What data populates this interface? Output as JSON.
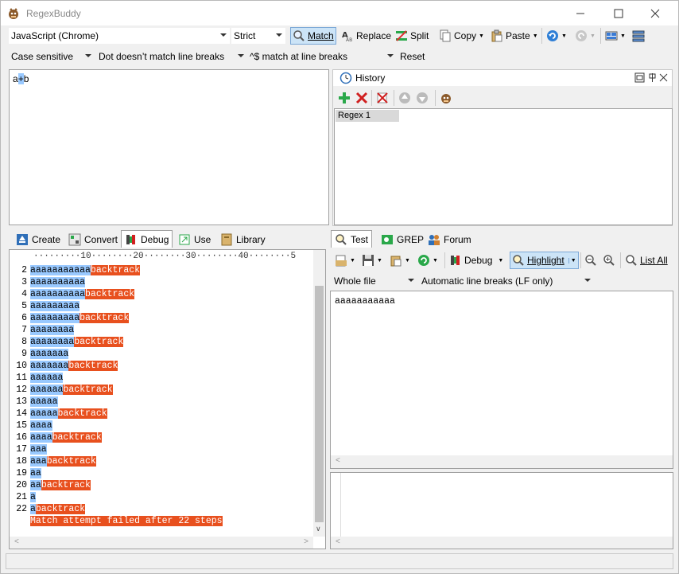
{
  "window": {
    "title": "RegexBuddy"
  },
  "toolbar1": {
    "flavor": "JavaScript (Chrome)",
    "mode": "Strict",
    "match": "Match",
    "replace": "Replace",
    "split": "Split",
    "copy": "Copy",
    "paste": "Paste"
  },
  "toolbar2": {
    "case": "Case sensitive",
    "dot": "Dot doesn’t match line breaks",
    "anchors": "^$ match at line breaks",
    "reset": "Reset"
  },
  "regex": {
    "before": "a",
    "cursor": "+",
    "after": "b"
  },
  "history": {
    "title": "History",
    "items": [
      "Regex 1"
    ]
  },
  "left_tabs": [
    "Create",
    "Convert",
    "Debug",
    "Use",
    "Library"
  ],
  "ruler": "·········10········20········30········40········5",
  "debug_lines": [
    {
      "n": "2",
      "hl": "aaaaaaaaaaa",
      "bt": "backtrack"
    },
    {
      "n": "3",
      "hl": "aaaaaaaaaa",
      "bt": ""
    },
    {
      "n": "4",
      "hl": "aaaaaaaaaa",
      "bt": "backtrack"
    },
    {
      "n": "5",
      "hl": "aaaaaaaaa",
      "bt": ""
    },
    {
      "n": "6",
      "hl": "aaaaaaaaa",
      "bt": "backtrack"
    },
    {
      "n": "7",
      "hl": "aaaaaaaa",
      "bt": ""
    },
    {
      "n": "8",
      "hl": "aaaaaaaa",
      "bt": "backtrack"
    },
    {
      "n": "9",
      "hl": "aaaaaaa",
      "bt": ""
    },
    {
      "n": "10",
      "hl": "aaaaaaa",
      "bt": "backtrack"
    },
    {
      "n": "11",
      "hl": "aaaaaa",
      "bt": ""
    },
    {
      "n": "12",
      "hl": "aaaaaa",
      "bt": "backtrack"
    },
    {
      "n": "13",
      "hl": "aaaaa",
      "bt": ""
    },
    {
      "n": "14",
      "hl": "aaaaa",
      "bt": "backtrack"
    },
    {
      "n": "15",
      "hl": "aaaa",
      "bt": ""
    },
    {
      "n": "16",
      "hl": "aaaa",
      "bt": "backtrack"
    },
    {
      "n": "17",
      "hl": "aaa",
      "bt": ""
    },
    {
      "n": "18",
      "hl": "aaa",
      "bt": "backtrack"
    },
    {
      "n": "19",
      "hl": "aa",
      "bt": ""
    },
    {
      "n": "20",
      "hl": "aa",
      "bt": "backtrack"
    },
    {
      "n": "21",
      "hl": "a",
      "bt": ""
    },
    {
      "n": "22",
      "hl": "a",
      "bt": "backtrack"
    }
  ],
  "debug_final": "Match attempt failed after 22 steps",
  "right_tabs": [
    "Test",
    "GREP",
    "Forum"
  ],
  "test_toolbar": {
    "debug": "Debug",
    "highlight": "Highlight",
    "listall": "List All"
  },
  "test_opts": {
    "scope": "Whole file",
    "linebreaks": "Automatic line breaks (LF only)"
  },
  "test_text": "aaaaaaaaaaa",
  "colors": {
    "highlight": "#99c9ff",
    "backtrack": "#e8501e",
    "accent": "#0078d7"
  }
}
